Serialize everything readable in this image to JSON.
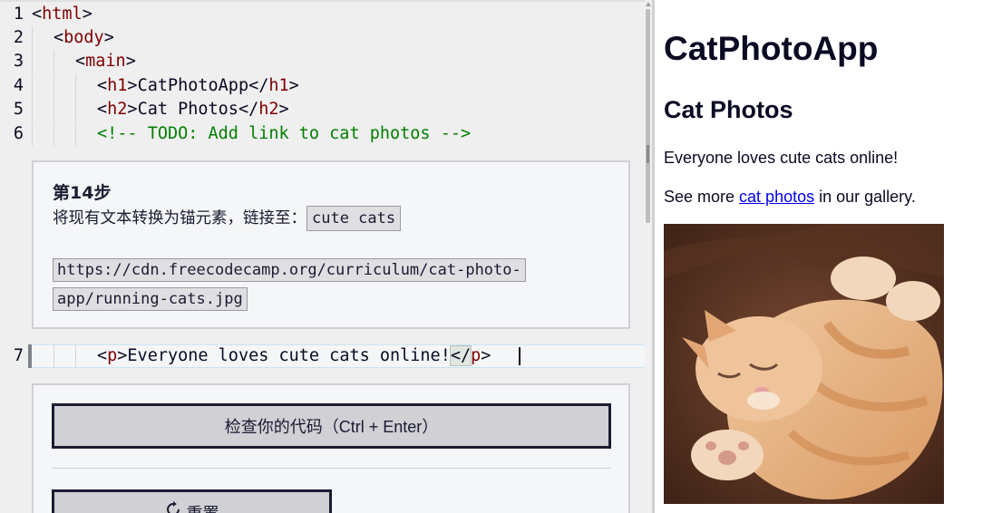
{
  "editor": {
    "lines": [
      {
        "num": "1",
        "open": "<",
        "tag": "html",
        "close": ">"
      },
      {
        "num": "2",
        "open": "<",
        "tag": "body",
        "close": ">"
      },
      {
        "num": "3",
        "open": "<",
        "tag": "main",
        "close": ">"
      },
      {
        "num": "4",
        "open": "<",
        "tag": "h1",
        "close": ">",
        "text": "CatPhotoApp",
        "endOpen": "</",
        "endTag": "h1",
        "endClose": ">"
      },
      {
        "num": "5",
        "open": "<",
        "tag": "h2",
        "close": ">",
        "text": "Cat Photos",
        "endOpen": "</",
        "endTag": "h2",
        "endClose": ">"
      },
      {
        "num": "6",
        "comment": "<!-- TODO: Add link to cat photos -->"
      }
    ],
    "active_line": {
      "num": "7",
      "open": "<",
      "tag": "p",
      "close": ">",
      "text": "Everyone loves cute cats online!",
      "endOpen": "</",
      "endTag": "p",
      "endClose": ">"
    }
  },
  "step": {
    "title": "第14步",
    "description": "将现有文本转换为锚元素，链接至：",
    "link_text": "cute cats",
    "url": "https://cdn.freecodecamp.org/curriculum/cat-photo-app/running-cats.jpg"
  },
  "actions": {
    "check_label": "检查你的代码（Ctrl + Enter）",
    "reset_label": "重置"
  },
  "preview": {
    "h1": "CatPhotoApp",
    "h2": "Cat Photos",
    "p1": "Everyone loves cute cats online!",
    "p2_before": "See more ",
    "p2_link": "cat photos",
    "p2_after": " in our gallery.",
    "image_subject": "sleeping orange tabby cat"
  },
  "colors": {
    "tag": "#800000",
    "comment": "#008000",
    "link": "#0000ee",
    "button_bg": "#d0d0d5",
    "button_border": "#1b1b32"
  }
}
